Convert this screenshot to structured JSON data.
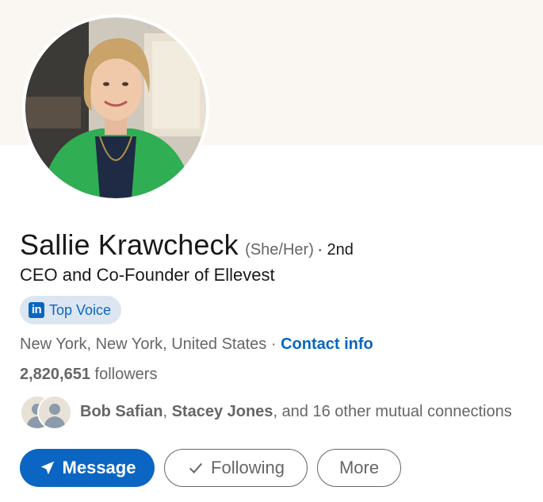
{
  "profile": {
    "name": "Sallie Krawcheck",
    "pronouns": "(She/Her)",
    "degree": "· 2nd",
    "headline": "CEO and Co-Founder of Ellevest",
    "badge": {
      "logo": "in",
      "label": "Top Voice"
    },
    "location": "New York, New York, United States",
    "separator": "·",
    "contact_label": "Contact info",
    "followers_count": "2,820,651",
    "followers_label": "followers",
    "mutual": {
      "name1": "Bob Safian",
      "comma": ",",
      "name2": "Stacey Jones",
      "rest": ", and 16 other mutual connections"
    }
  },
  "actions": {
    "message_label": "Message",
    "following_label": "Following",
    "more_label": "More"
  },
  "colors": {
    "brand_blue": "#0a66c2",
    "banner": "#faf7f2",
    "badge_bg": "#dce6f1",
    "muted_text": "#666666"
  },
  "icons": [
    "profile-photo",
    "linkedin-logo-icon",
    "send-icon",
    "checkmark-icon",
    "mutual-connection-avatar"
  ]
}
